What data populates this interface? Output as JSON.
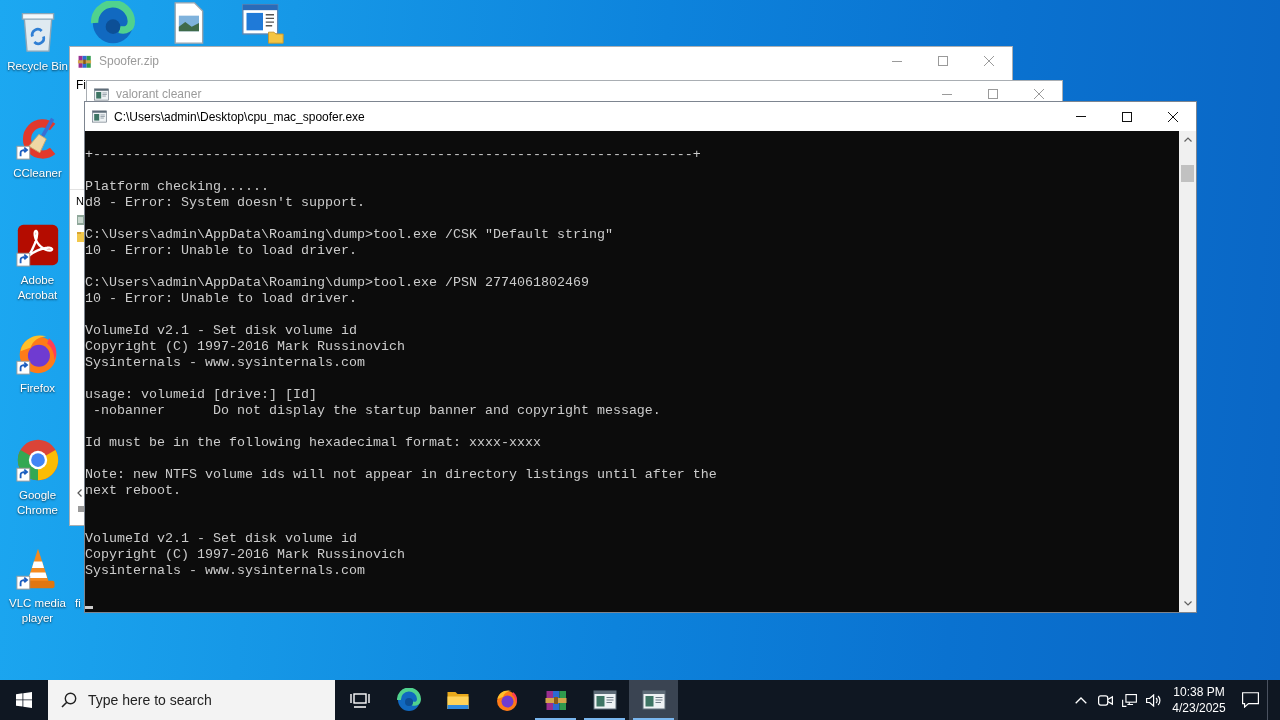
{
  "desktop": {
    "icons": [
      {
        "kind": "recycle",
        "label": "Recycle Bin",
        "shortcut": false
      },
      {
        "kind": "edge",
        "shortcut": false
      },
      {
        "kind": "image",
        "shortcut": false
      },
      {
        "kind": "app",
        "shortcut": false
      },
      {
        "kind": "cleaner",
        "label": "CCleaner",
        "shortcut": true
      },
      {
        "kind": "pdf",
        "label": "Adobe Acrobat",
        "shortcut": true
      },
      {
        "kind": "firefox",
        "label": "Firefox",
        "shortcut": true
      },
      {
        "kind": "chrome",
        "label": "Google Chrome",
        "shortcut": true
      },
      {
        "kind": "vlc",
        "label": "VLC media player",
        "shortcut": true
      },
      {
        "kind": "covered",
        "label": "fi"
      }
    ]
  },
  "windows": [
    {
      "kind": "archive",
      "title": "Spoofer.zip",
      "active": false,
      "menu": [
        "Fi"
      ],
      "columns": [
        "N"
      ]
    },
    {
      "kind": "console",
      "title": "valorant cleaner",
      "active": false
    },
    {
      "kind": "console",
      "title": "C:\\Users\\admin\\Desktop\\cpu_mac_spoofer.exe",
      "active": true,
      "output": [
        {
          "blocks": [
            {
              "lines": [
                "+---------------------------------------------------------------------------+"
              ]
            },
            {
              "lines": [
                "Platform checking......",
                "d8 - Error: System doesn't support."
              ]
            },
            {
              "lines": [
                "C:\\Users\\admin\\AppData\\Roaming\\dump>tool.exe /CSK \"Default string\"",
                "10 - Error: Unable to load driver."
              ]
            },
            {
              "lines": [
                "C:\\Users\\admin\\AppData\\Roaming\\dump>tool.exe /PSN 2774061802469",
                "10 - Error: Unable to load driver."
              ]
            },
            {
              "lines": [
                "VolumeId v2.1 - Set disk volume id",
                "Copyright (C) 1997-2016 Mark Russinovich",
                "Sysinternals - www.sysinternals.com"
              ]
            },
            {
              "lines": [
                "usage: volumeid [drive:] [Id]",
                " -nobanner      Do not display the startup banner and copyright message."
              ]
            },
            {
              "lines": [
                "Id must be in the following hexadecimal format: xxxx-xxxx"
              ]
            },
            {
              "lines": [
                "Note: new NTFS volume ids will not appear in directory listings until after the",
                "next reboot."
              ]
            }
          ]
        },
        {
          "blocks": [
            {
              "lines": [
                "VolumeId v2.1 - Set disk volume id",
                "Copyright (C) 1997-2016 Mark Russinovich",
                "Sysinternals - www.sysinternals.com"
              ]
            }
          ]
        }
      ]
    }
  ],
  "taskbar": {
    "search": {
      "placeholder": "Type here to search"
    },
    "apps": [
      {
        "kind": "edge",
        "running": false,
        "active": false
      },
      {
        "kind": "explorer",
        "running": false,
        "active": false
      },
      {
        "kind": "firefox",
        "running": false,
        "active": false
      },
      {
        "kind": "archive",
        "running": true,
        "active": false
      },
      {
        "kind": "console",
        "running": true,
        "active": false
      },
      {
        "kind": "console",
        "running": true,
        "active": true
      }
    ],
    "clock": {
      "time": "10:38 PM",
      "date": "4/23/2025"
    }
  }
}
